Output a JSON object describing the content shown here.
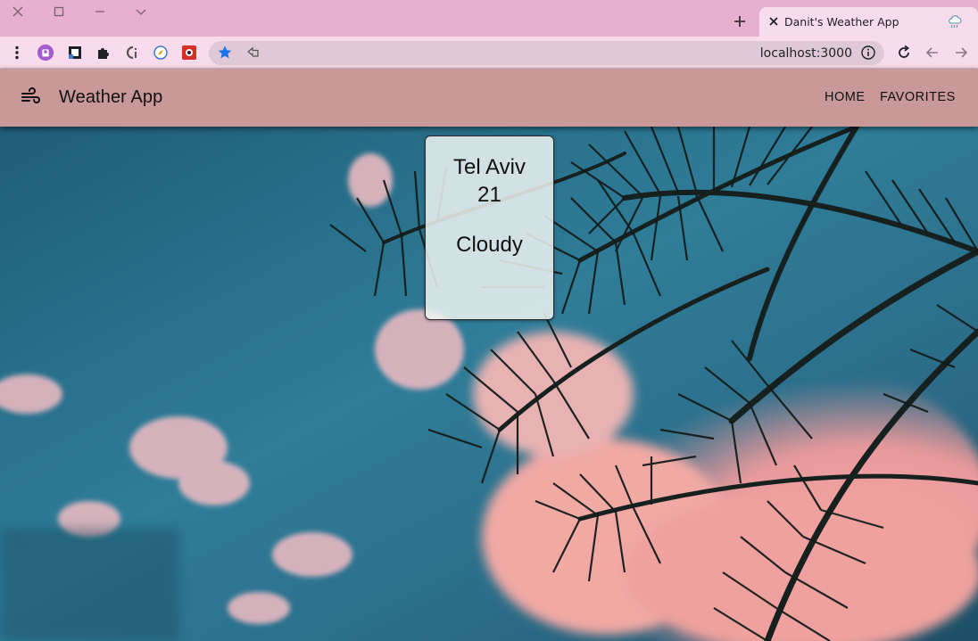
{
  "browser": {
    "tab_title": "Danit's Weather App",
    "url": "localhost:3000"
  },
  "app": {
    "title": "Weather App",
    "nav": {
      "home": "HOME",
      "favorites": "FAVORITES"
    }
  },
  "weather": {
    "city": "Tel Aviv",
    "temperature": "21",
    "condition": "Cloudy"
  },
  "icons": {
    "app_logo": "wind-icon",
    "tab_favicon": "cloud-rain-icon"
  },
  "colors": {
    "appbar": "#c99898",
    "titlebar": "#e7b0d0",
    "toolbar": "#f9dcec"
  }
}
